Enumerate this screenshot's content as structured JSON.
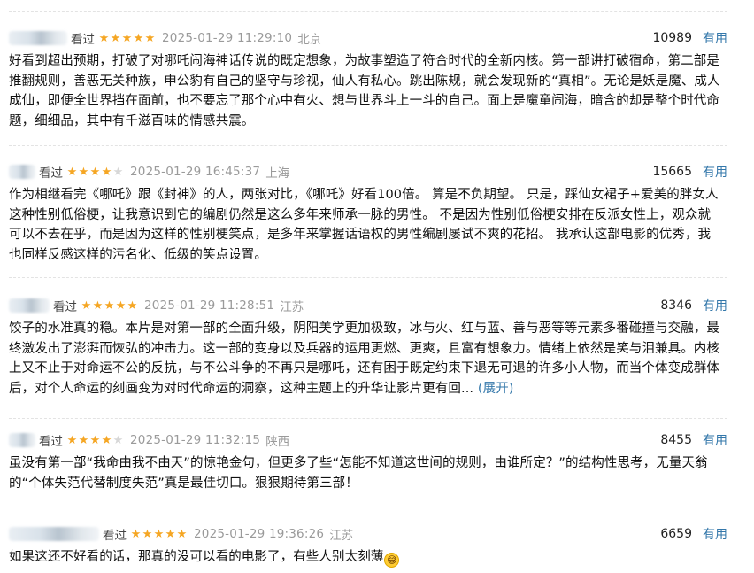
{
  "seen_label": "看过",
  "useful_label": "有用",
  "expand_label": "(展开)",
  "colors": {
    "star": "#f5a623",
    "link": "#3377aa",
    "meta": "#9a9a9a"
  },
  "reviews": [
    {
      "rating": 5,
      "time": "2025-01-29 11:29:10",
      "location": "北京",
      "votes": "10989",
      "text": "好看到超出预期，打破了对哪吒闹海神话传说的既定想象，为故事塑造了符合时代的全新内核。第一部讲打破宿命，第二部是推翻规则，善恶无关种族，申公豹有自己的坚守与珍视，仙人有私心。跳出陈规，就会发现新的“真相”。无论是妖是魔、成人成仙，即便全世界挡在面前，也不要忘了那个心中有火、想与世界斗上一斗的自己。面上是魔童闹海，暗含的却是整个时代命题，细细品，其中有千滋百味的情感共震。"
    },
    {
      "rating": 4,
      "time": "2025-01-29 16:45:37",
      "location": "上海",
      "votes": "15665",
      "text": "作为相继看完《哪吒》跟《封神》的人，两张对比，《哪吒》好看100倍。 算是不负期望。 只是，踩仙女裙子+爱美的胖女人这种性别低俗梗，让我意识到它的编剧仍然是这么多年来师承一脉的男性。 不是因为性别低俗梗安排在反派女性上，观众就可以不去在乎，而是因为这样的性别梗笑点，是多年来掌握话语权的男性编剧屡试不爽的花招。 我承认这部电影的优秀，我也同样反感这样的污名化、低级的笑点设置。"
    },
    {
      "rating": 5,
      "time": "2025-01-29 11:28:51",
      "location": "江苏",
      "votes": "8346",
      "text": "饺子的水准真的稳。本片是对第一部的全面升级，阴阳美学更加极致，冰与火、红与蓝、善与恶等等元素多番碰撞与交融，最终激发出了澎湃而恢弘的冲击力。这一部的变身以及兵器的运用更燃、更爽，且富有想象力。情绪上依然是笑与泪兼具。内核上又不止于对命运不公的反抗，与不公斗争的不再只是哪吒，还有困于既定约束下退无可退的许多小人物，而当个体变成群体后，对个人命运的刻画变为对时代命运的洞察，这种主题上的升华让影片更有回..."
    },
    {
      "rating": 4,
      "time": "2025-01-29 11:32:15",
      "location": "陕西",
      "votes": "8455",
      "text": "虽没有第一部“我命由我不由天”的惊艳金句，但更多了些“怎能不知道这世间的规则，由谁所定？”的结构性思考，无量天翁的“个体失范代替制度失范”真是最佳切口。狠狠期待第三部！"
    },
    {
      "rating": 5,
      "time": "2025-01-29 19:36:26",
      "location": "江苏",
      "votes": "6659",
      "text": "如果这还不好看的话，那真的没可以看的电影了，有些人别太刻薄",
      "emoji": "😅"
    }
  ]
}
